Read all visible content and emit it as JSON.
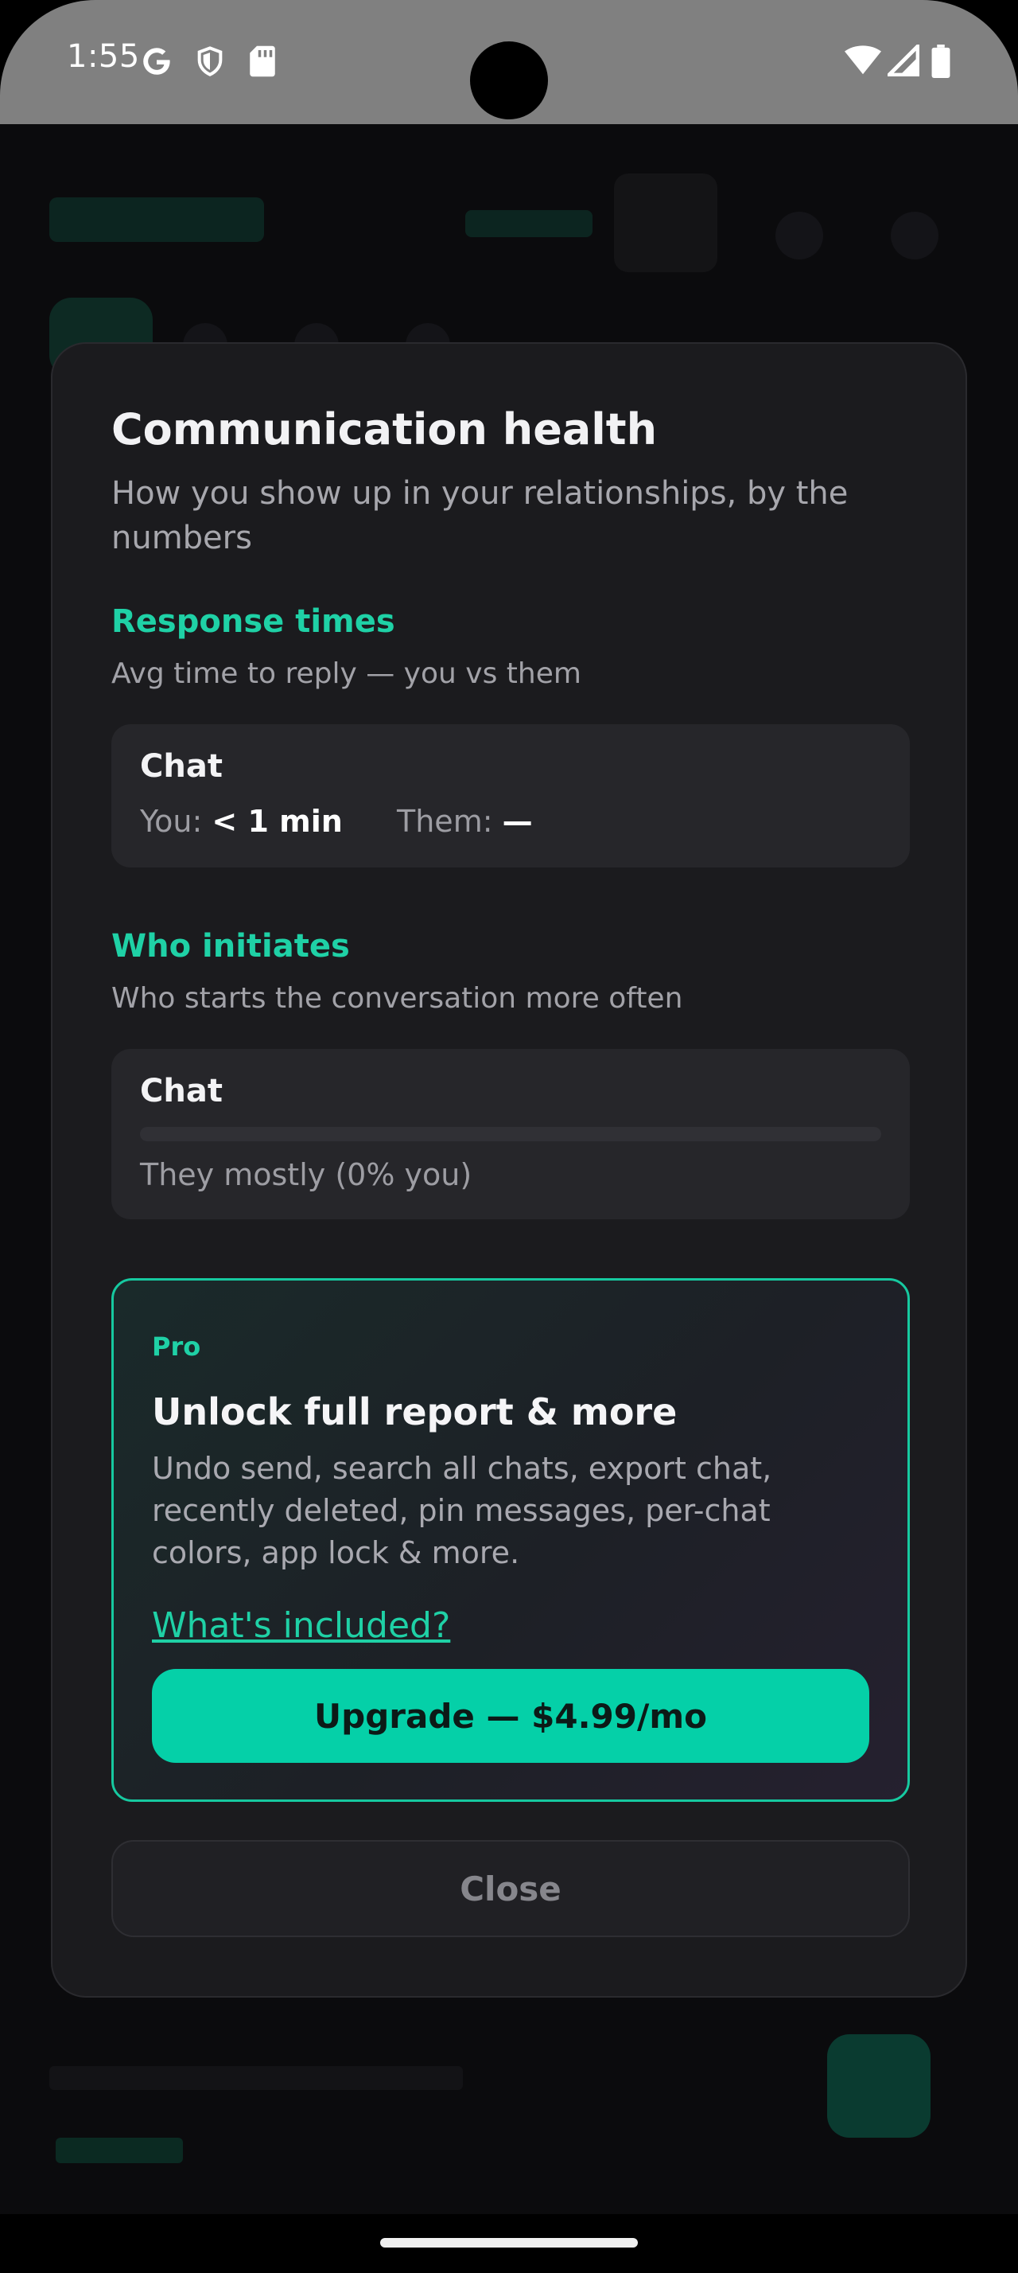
{
  "status_bar": {
    "time": "1:55",
    "left_icons": [
      "google-icon",
      "shield-icon",
      "sd-card-icon"
    ],
    "right_icons": [
      "wifi-icon",
      "signal-icon",
      "battery-icon"
    ]
  },
  "modal": {
    "title": "Communication health",
    "subtitle": "How you show up in your relationships, by the numbers",
    "response_times": {
      "title": "Response times",
      "subtitle": "Avg time to reply — you vs them",
      "card": {
        "name": "Chat",
        "you_label": "You:",
        "you_value": "< 1 min",
        "them_label": "Them:",
        "them_value": "—"
      }
    },
    "who_initiates": {
      "title": "Who initiates",
      "subtitle": "Who starts the conversation more often",
      "card": {
        "name": "Chat",
        "you_share": 0,
        "caption": "They mostly (0% you)"
      }
    },
    "pro": {
      "badge": "Pro",
      "title": "Unlock full report & more",
      "description": "Undo send, search all chats, export chat, recently deleted, pin messages, per-chat colors, app lock & more.",
      "link": "What's included?",
      "upgrade_button": "Upgrade — $4.99/mo"
    },
    "close_button": "Close"
  },
  "colors": {
    "accent": "#1fd1a6",
    "button": "#05d0a8",
    "modal_bg": "#1b1b1e",
    "card_bg": "#26262a"
  }
}
